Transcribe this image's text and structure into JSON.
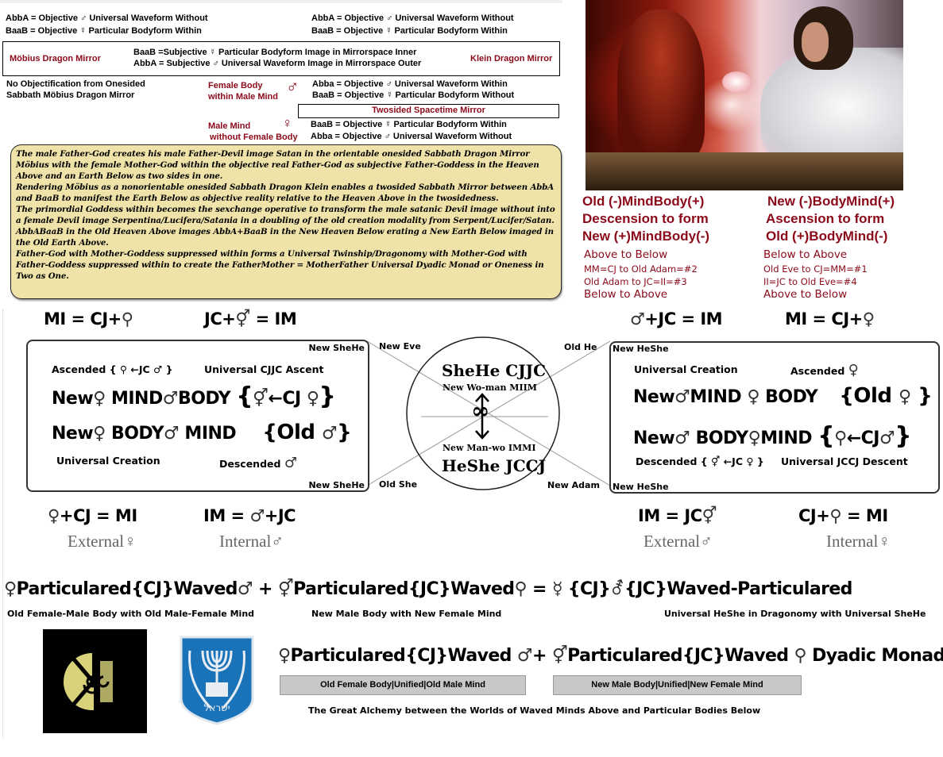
{
  "top_left": {
    "line1": "AbbA = Objective ♂  Universal Waveform Without",
    "line2": "BaaB = Objective ☿ Particular Bodyform Within"
  },
  "top_right": {
    "line1": "AbbA = Objective ♂  Universal Waveform Without",
    "line2": "BaaB = Objective ☿ Particular Bodyform Within"
  },
  "mirror_box": {
    "left_label": "Möbius Dragon Mirror",
    "right_label": "Klein Dragon Mirror",
    "line1": "BaaB =Subjective ☿ Particular Bodyform Image in Mirrorspace Inner",
    "line2": "AbbA = Subjective ♂ Universal Waveform Image in Mirrorspace Outer"
  },
  "no_objectification": {
    "line1": "No Objectification from Onesided",
    "line2": "Sabbath Möbius Dragon Mirror"
  },
  "female_body": {
    "line1": "Female Body",
    "line2": "within Male Mind",
    "symbol": "♂",
    "text1": "Abba = Objective ♂ Universal Waveform Within",
    "text2": "BaaB = Objective ☿ Particular Bodyform Without"
  },
  "twosided_label": "Twosided Spacetime Mirror",
  "male_mind": {
    "line1": "Male Mind",
    "line2": "without Female Body",
    "symbol": "♀",
    "text1": "BaaB = Objective ☿ Particular Bodyform Within",
    "text2": "Abba = Objective ♂ Universal Waveform Without"
  },
  "narrative": [
    "The male Father-God creates his male Father-Devil image Satan in the orientable onesided Sabbath Dragon Mirror Möbius with the female Mother-God within the objective real Father-God as subjective Father-Goddess in the Heaven Above and an Earth Below as two sides in one.",
    "Rendering Möbius as a nonorientable onesided Sabbath Dragon Klein enables a twosided Sabbath Mirror between AbbA and BaaB to manifest the Earth Below as objective reality relative to the Heaven Above in the twosidedness.",
    "The primordial Goddess within becomes the sexchange operative to transform the male satanic Devil image without into a female Devil image Serpentina/Lucifera/Satania in a doubling of the old creation modality from Serpent/Lucifer/Satan.",
    "AbbABaaB in the Old Heaven Above images AbbA+BaaB in the New Heaven Below erating a New Earth Below imaged in the Old Earth Above.",
    "Father-God with Mother-Goddess suppressed within forms a Universal Twinship/Dragonomy with Mother-God with Father-Goddess suppressed within to create the FatherMother = MotherFather Universal Dyadic Monad or Oneness in Two as One."
  ],
  "photo": {
    "alt": "Devil and Christ arm wrestling"
  },
  "left_heading": [
    "Old (-)MindBody(+)",
    "Descension to form",
    "New (+)MindBody(-)"
  ],
  "left_sub": [
    "Above to Below",
    "MM=CJ to Old Adam=#2",
    "Old Adam to JC=II=#3",
    "Below to Above"
  ],
  "right_heading": [
    "New (-)BodyMind(+)",
    "Ascension to form",
    "Old (+)BodyMind(-)"
  ],
  "right_sub": [
    "Below to Above",
    "Old Eve to CJ=MM=#1",
    "II=JC to Old Eve=#4",
    "Above to Below"
  ],
  "equations_top": {
    "left1": "MI = CJ+",
    "left1_sym": "⚲",
    "left2_pre": "JC+",
    "left2_sym": "⚥",
    "left2_post": " = IM",
    "right1_sym": "♂",
    "right1": "+JC = IM",
    "right2": "MI = CJ+",
    "right2_sym": "♀"
  },
  "left_box": {
    "corner_top": "New SheHe",
    "corner_bottom": "New SheHe",
    "ascended": "Ascended { ⚲ ←JC ♂ }",
    "ascent": "Universal CJJC Ascent",
    "line1_a": "New",
    "line1_s1": "♀",
    "line1_b": " MIND",
    "line1_s2": "♂",
    "line1_c": "BODY",
    "line1_d": "{",
    "line1_s3": "⚥",
    "line1_e": "←CJ ",
    "line1_s4": "♀",
    "line1_f": "}",
    "line2_a": "New",
    "line2_s1": "♀",
    "line2_b": " BODY",
    "line2_s2": "♂",
    "line2_c": " MIND",
    "line2_d": "{Old ",
    "line2_s3": "♂",
    "line2_e": "}",
    "creation": "Universal Creation",
    "descended": "Descended",
    "descended_sym": "♂"
  },
  "center": {
    "new_eve": "New Eve",
    "old_he": "Old  He",
    "old_she": "Old She",
    "new_adam": "New Adam",
    "shehe": "SheHe CJJC",
    "woman": "New Wo-man MIIM",
    "man": "New Man-wo IMMI",
    "heshe": "HeShe JCCJ",
    "infinity": "∞"
  },
  "right_box": {
    "corner_top": "New HeShe",
    "corner_bottom": "New HeShe",
    "creation": "Universal Creation",
    "ascended": "Ascended",
    "ascended_sym": "♀",
    "line1_a": "New",
    "line1_s1": "♂",
    "line1_b": "MIND ",
    "line1_s2": "♀",
    "line1_c": " BODY",
    "line1_d": "{Old ",
    "line1_s3": "♀",
    "line1_e": " }",
    "line2_a": "New",
    "line2_s1": "♂",
    "line2_b": " BODY",
    "line2_s2": "♀",
    "line2_c": "MIND",
    "line2_d": "{",
    "line2_s3": "⚲",
    "line2_e": "←CJ",
    "line2_s4": "♂",
    "line2_f": "}",
    "descended": "Descended { ⚥ ←JC ♀ }",
    "descent": "Universal JCCJ Descent"
  },
  "equations_mid": {
    "e1_sym": "♀",
    "e1": "+CJ = MI",
    "e1_sub": "External",
    "e1_sub_sym": "♀",
    "e2": "IM = ",
    "e2_sym": "♂",
    "e2_post": "+JC",
    "e2_sub": "Internal",
    "e2_sub_sym": "♂",
    "e3": "IM = JC",
    "e3_sym": "⚥",
    "e3_sub": "External",
    "e3_sub_sym": "♂",
    "e4": "CJ+",
    "e4_sym": "⚲",
    "e4_post": " = MI",
    "e4_sub": "Internal",
    "e4_sub_sym": "♀"
  },
  "particulared_row1": {
    "s1": "♀",
    "p1": "Particulared{CJ}Waved",
    "s2": "♂",
    "plus": " +",
    "s3": "⚥",
    "p2": "Particulared{JC}Waved",
    "s4": "⚲",
    "eq": " = ",
    "s5": "☿",
    "p3a": " {CJ}",
    "s6": "⚦",
    "p3b": "{JC}Waved-Particulared",
    "cap1": "Old Female-Male Body with Old Male-Female Mind",
    "cap2": "New Male Body with New Female Mind",
    "cap3": "Universal HeShe in Dragonomy with Universal SheHe"
  },
  "particulared_row2": {
    "s1": "♀",
    "p1": "Particulared{CJ}Waved ",
    "s2": "♂",
    "plus": "+ ",
    "s3": "⚥",
    "p2": "Particulared{JC}Waved ",
    "s4": "⚲",
    "p3": " Dyadic Monad",
    "box1": "Old Female Body|Unified|Old Male Mind",
    "box2": "New Male Body|Unified|New Female Mind",
    "caption": "The Great Alchemy between the Worlds of Waved Minds Above and Particular Bodies Below"
  },
  "emblems": {
    "hunab_ku": "Hunab Ku emblem",
    "israel": "Emblem of Israel",
    "israel_text": "ישראל"
  },
  "colors": {
    "maroon": "#8b0a1a",
    "tan": "#efe3a9",
    "emblem_blue": "#1a73b8",
    "hunab_gold": "#d8d27a",
    "caption_gray": "#c8c8c8"
  }
}
